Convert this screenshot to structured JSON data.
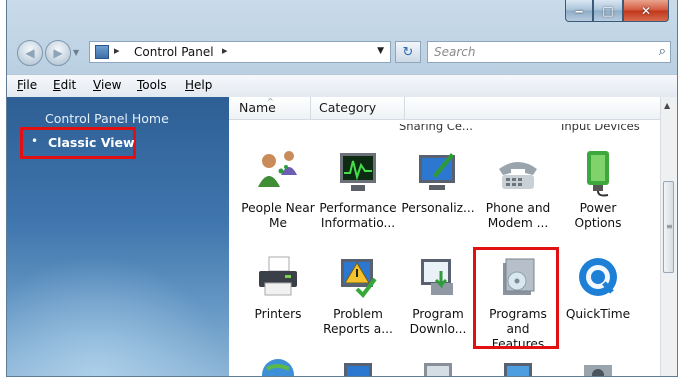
{
  "window": {
    "caption": {
      "minimize": "‒",
      "maximize": "□",
      "close": "✕"
    }
  },
  "nav": {
    "back_icon": "◀",
    "forward_icon": "▶",
    "dropdown_icon": "▼",
    "address": {
      "sep1": "▸",
      "location": "Control Panel",
      "sep2": "▸",
      "dropdown": "▼"
    },
    "refresh_icon": "↻",
    "search": {
      "placeholder": "Search",
      "icon": "⌕"
    }
  },
  "menu": {
    "file": {
      "u": "F",
      "rest": "ile"
    },
    "edit": {
      "u": "E",
      "rest": "dit"
    },
    "view": {
      "u": "V",
      "rest": "iew"
    },
    "tools": {
      "u": "T",
      "rest": "ools"
    },
    "help": {
      "u": "H",
      "rest": "elp"
    }
  },
  "sidebar": {
    "home_link": "Control Panel Home",
    "bullet": "•",
    "classic_view": "Classic View",
    "highlight_color": "#e21010"
  },
  "content": {
    "columns": {
      "name": "Name",
      "category": "Category",
      "sort_icon": "^"
    },
    "cut_labels": {
      "left": "Sharing Ce...",
      "right": "Input Devices"
    },
    "items": [
      {
        "label": "People Near Me",
        "icon": "people-near-me-icon"
      },
      {
        "label": "Performance Informatio...",
        "icon": "performance-icon"
      },
      {
        "label": "Personaliz...",
        "icon": "personalization-icon"
      },
      {
        "label": "Phone and Modem ...",
        "icon": "phone-modem-icon"
      },
      {
        "label": "Power Options",
        "icon": "power-options-icon"
      },
      {
        "label": "Printers",
        "icon": "printer-icon"
      },
      {
        "label": "Problem Reports a...",
        "icon": "problem-reports-icon"
      },
      {
        "label": "Program Downlo...",
        "icon": "program-download-icon"
      },
      {
        "label": "Programs and Features",
        "icon": "programs-features-icon"
      },
      {
        "label": "QuickTime",
        "icon": "quicktime-icon"
      }
    ]
  },
  "scrollbar": {
    "up": "▲",
    "grip": "≡"
  }
}
